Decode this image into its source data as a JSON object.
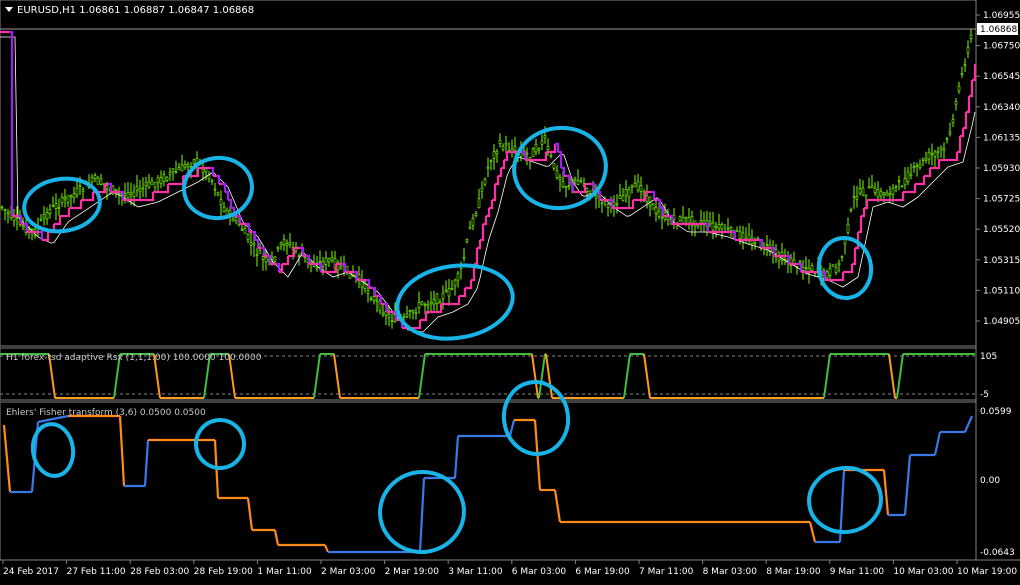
{
  "window": {
    "symbol_header": "EURUSD,H1  1.06861 1.06887 1.06847 1.06868",
    "dropdown_icon": "triangle-down-icon"
  },
  "main_panel": {
    "price_axis_labels": [
      "1.06955",
      "1.06750",
      "1.06545",
      "1.06340",
      "1.06135",
      "1.05930",
      "1.05725",
      "1.05520",
      "1.05315",
      "1.05110",
      "1.04905"
    ],
    "current_price_label": "1.06868",
    "colors": {
      "candles": "#7cfc00",
      "rsx_line_up": "#ff2fa8",
      "rsx_line_down": "#a020f0",
      "envelope_line": "#ffffff",
      "annotation_circles": "#18b4e8"
    }
  },
  "rsx_panel": {
    "title": "H1 forex-tsd adaptive Rsx (1,1,1.00) 100.0000 100.0000",
    "axis_labels": [
      "105",
      "-5"
    ],
    "colors": {
      "up": "#3fbf3f",
      "down": "#ff9a1a"
    }
  },
  "fisher_panel": {
    "title": "Ehlers' Fisher transform (3,6) 0.0500 0.0500",
    "axis_labels": [
      "0.0599",
      "0.00",
      "-0.0643"
    ],
    "colors": {
      "up": "#3a78e8",
      "down": "#ff8a1a"
    }
  },
  "time_axis": {
    "labels": [
      "24 Feb 2017",
      "27 Feb 11:00",
      "28 Feb 03:00",
      "28 Feb 19:00",
      "1 Mar 11:00",
      "2 Mar 03:00",
      "2 Mar 19:00",
      "3 Mar 11:00",
      "6 Mar 03:00",
      "6 Mar 19:00",
      "7 Mar 11:00",
      "8 Mar 03:00",
      "8 Mar 19:00",
      "9 Mar 11:00",
      "10 Mar 03:00",
      "10 Mar 19:00"
    ]
  }
}
